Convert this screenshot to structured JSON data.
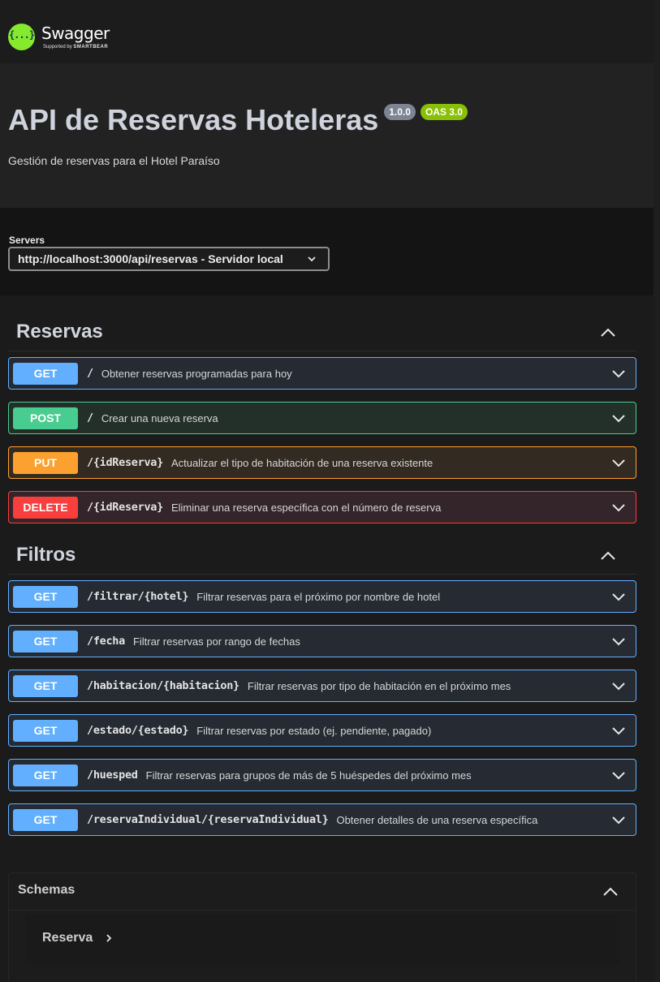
{
  "brand": {
    "name": "Swagger",
    "sub_prefix": "Supported by",
    "sub_brand": "SMARTBEAR",
    "logo_glyph": "{...}",
    "accent": "#85ea2d"
  },
  "info": {
    "title": "API de Reservas Hoteleras",
    "version": "1.0.0",
    "oas": "OAS 3.0",
    "description": "Gestión de reservas para el Hotel Paraíso"
  },
  "servers": {
    "label": "Servers",
    "selected": "http://localhost:3000/api/reservas - Servidor local"
  },
  "sections": [
    {
      "title": "Reservas",
      "operations": [
        {
          "method": "GET",
          "path": "/",
          "summary": "Obtener reservas programadas para hoy"
        },
        {
          "method": "POST",
          "path": "/",
          "summary": "Crear una nueva reserva"
        },
        {
          "method": "PUT",
          "path": "/{idReserva}",
          "summary": "Actualizar el tipo de habitación de una reserva existente"
        },
        {
          "method": "DELETE",
          "path": "/{idReserva}",
          "summary": "Eliminar una reserva específica con el número de reserva"
        }
      ]
    },
    {
      "title": "Filtros",
      "operations": [
        {
          "method": "GET",
          "path": "/filtrar/{hotel}",
          "summary": "Filtrar reservas para el próximo por nombre de hotel"
        },
        {
          "method": "GET",
          "path": "/fecha",
          "summary": "Filtrar reservas por rango de fechas"
        },
        {
          "method": "GET",
          "path": "/habitacion/{habitacion}",
          "summary": "Filtrar reservas por tipo de habitación en el próximo mes"
        },
        {
          "method": "GET",
          "path": "/estado/{estado}",
          "summary": "Filtrar reservas por estado (ej. pendiente, pagado)"
        },
        {
          "method": "GET",
          "path": "/huesped",
          "summary": "Filtrar reservas para grupos de más de 5 huéspedes del próximo mes"
        },
        {
          "method": "GET",
          "path": "/reservaIndividual/{reservaIndividual}",
          "summary": "Obtener detalles de una reserva específica"
        }
      ]
    }
  ],
  "schemas": {
    "title": "Schemas",
    "models": [
      "Reserva"
    ]
  },
  "colors": {
    "get": "#61affe",
    "post": "#49cc90",
    "put": "#fca130",
    "delete": "#f93e3e",
    "version_badge": "#7d8492",
    "oas_badge": "#89bf04"
  }
}
